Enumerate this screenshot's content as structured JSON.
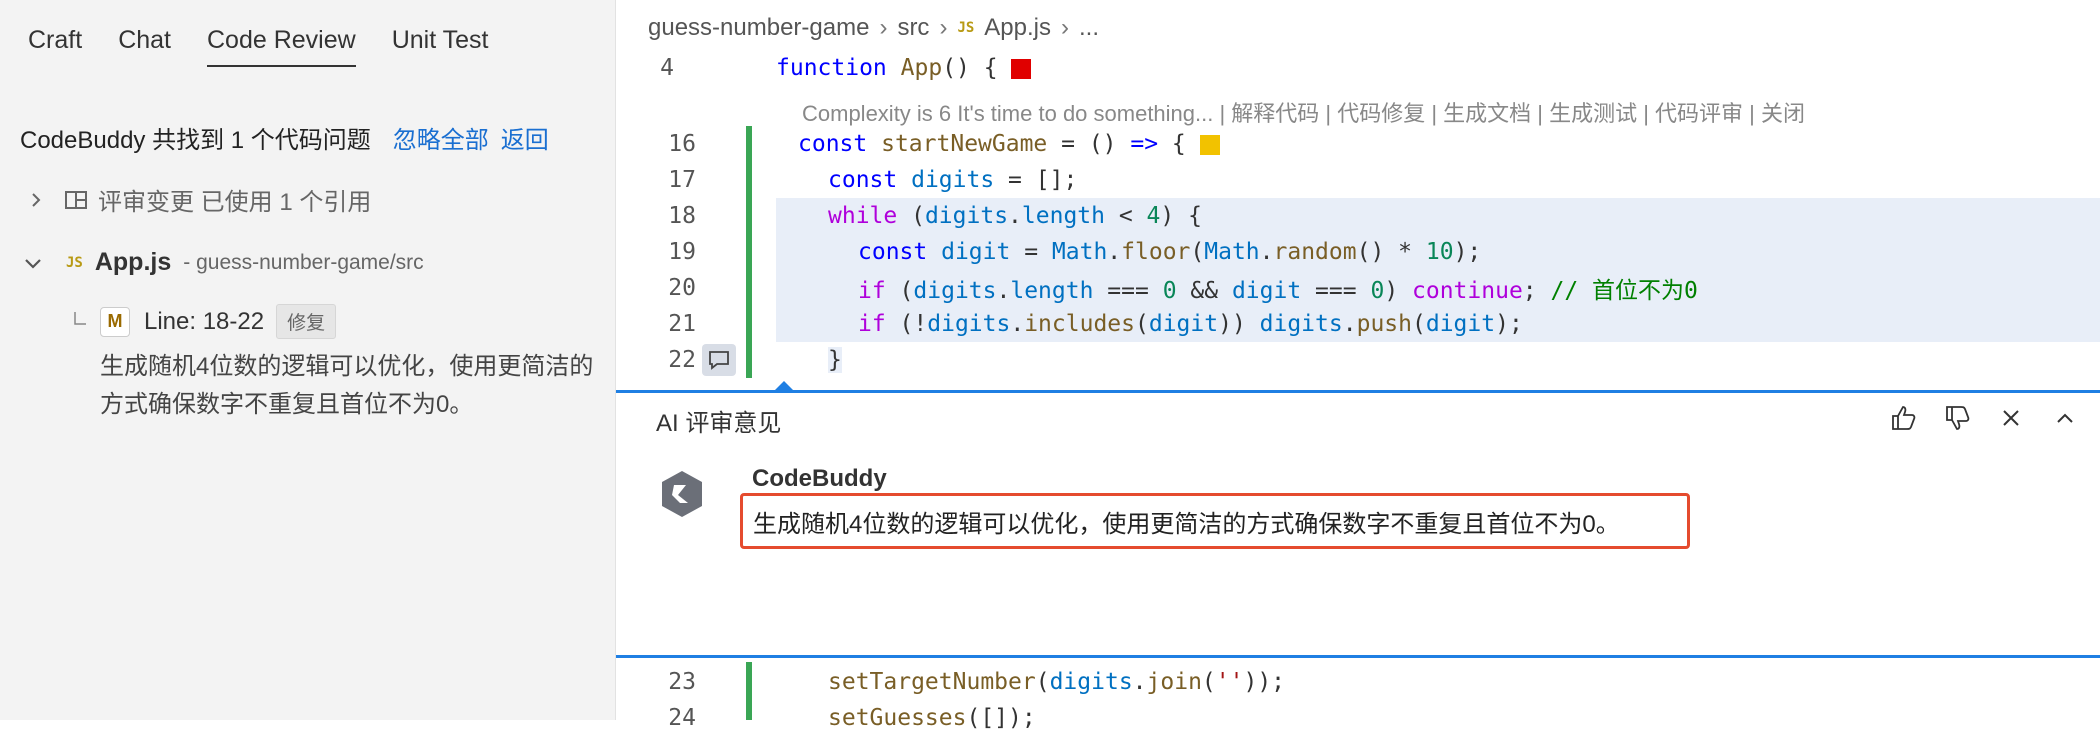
{
  "left": {
    "tabs": [
      {
        "label": "Craft"
      },
      {
        "label": "Chat"
      },
      {
        "label": "Code Review"
      },
      {
        "label": "Unit Test"
      }
    ],
    "summary": "CodeBuddy 共找到 1 个代码问题",
    "ignore_all": "忽略全部",
    "back": "返回",
    "review_changes": "评审变更 已使用 1 个引用",
    "file": {
      "badge": "JS",
      "name": "App.js",
      "path": "- guess-number-game/src"
    },
    "issue": {
      "badge": "M",
      "line": "Line: 18-22",
      "fix": "修复",
      "desc": "生成随机4位数的逻辑可以优化，使用更简洁的方式确保数字不重复且首位不为0。"
    }
  },
  "editor": {
    "breadcrumb": {
      "project": "guess-number-game",
      "folder": "src",
      "badge": "JS",
      "file": "App.js",
      "more": "..."
    },
    "codelens": "Complexity is 6 It's time to do something... | 解释代码 | 代码修复 | 生成文档 | 生成测试 | 代码评审 | 关闭",
    "line_numbers": {
      "l4": "4",
      "l16": "16",
      "l17": "17",
      "l18": "18",
      "l19": "19",
      "l20": "20",
      "l21": "21",
      "l22": "22",
      "l23": "23",
      "l24": "24"
    },
    "review": {
      "title": "AI 评审意见",
      "author": "CodeBuddy",
      "comment": "生成随机4位数的逻辑可以优化，使用更简洁的方式确保数字不重复且首位不为0。"
    },
    "colors": {
      "accent": "#1f7fe3",
      "highlight_border": "#e54b2e",
      "gutter_added": "#3aa655",
      "marker_red": "#e00000",
      "marker_yellow": "#f2c200"
    }
  }
}
